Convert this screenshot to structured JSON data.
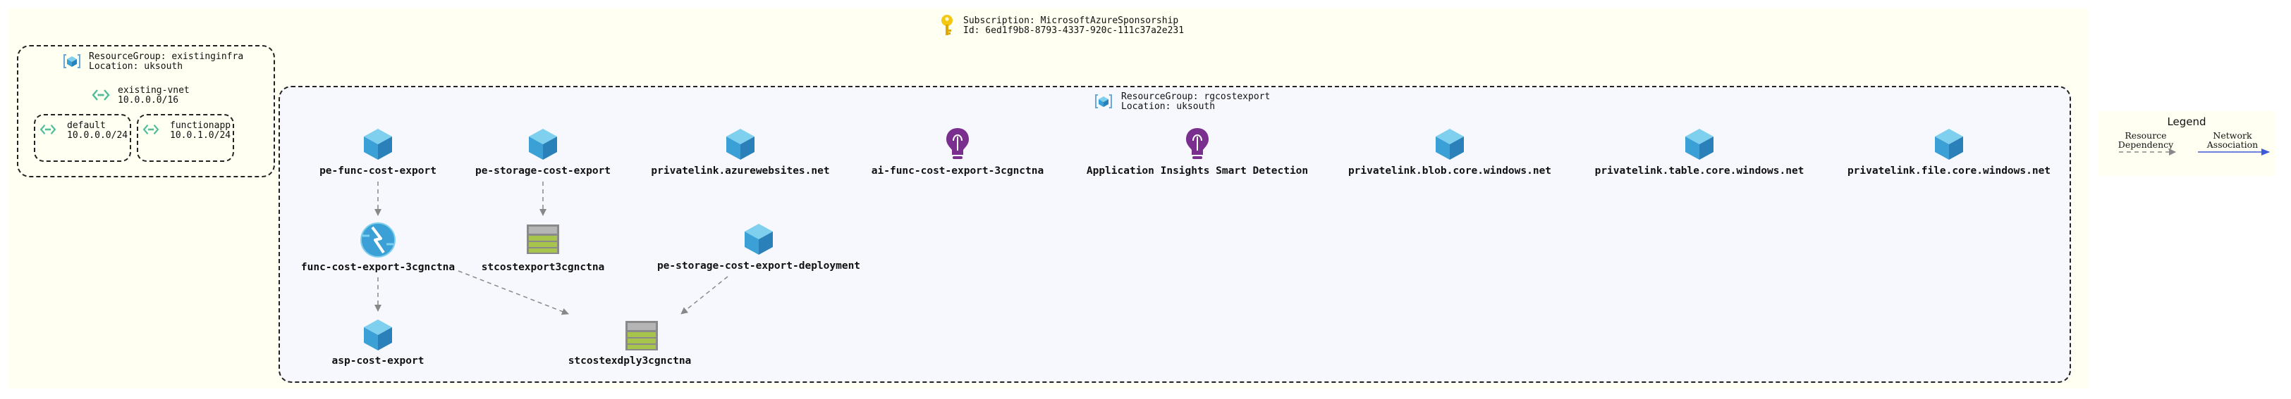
{
  "subscription": {
    "name_line": "Subscription: MicrosoftAzureSponsorship",
    "id_line": "Id: 6ed1f9b8-8793-4337-920c-111c37a2e231"
  },
  "rg_infra": {
    "name_line": "ResourceGroup: existinginfra",
    "location_line": "Location: uksouth",
    "vnet": {
      "name": "existing-vnet",
      "cidr": "10.0.0.0/16"
    },
    "subnets": [
      {
        "name": "default",
        "cidr": "10.0.0.0/24"
      },
      {
        "name": "functionapp",
        "cidr": "10.0.1.0/24"
      }
    ]
  },
  "rg_main": {
    "name_line": "ResourceGroup: rgcostexport",
    "location_line": "Location: uksouth"
  },
  "nodes": {
    "pe_func": "pe-func-cost-export",
    "pe_storage": "pe-storage-cost-export",
    "pl_websites": "privatelink.azurewebsites.net",
    "ai_func": "ai-func-cost-export-3cgnctna",
    "ai_smart": "Application Insights Smart Detection",
    "pl_blob": "privatelink.blob.core.windows.net",
    "pl_table": "privatelink.table.core.windows.net",
    "pl_file": "privatelink.file.core.windows.net",
    "func_app": "func-cost-export-3cgnctna",
    "st_export": "stcostexport3cgnctna",
    "pe_storage_deploy": "pe-storage-cost-export-deployment",
    "asp": "asp-cost-export",
    "st_deploy": "stcostexdply3cgnctna"
  },
  "legend": {
    "title": "Legend",
    "resource_dependency": "Resource\nDependency",
    "network_association": "Network\nAssociation"
  },
  "colors": {
    "background_area": "#fffff2",
    "resource_group_fill": "#f7f8fd",
    "dependency_edge": "#888888",
    "network_edge": "#3b5bdb",
    "cube_light": "#7fd0ef",
    "cube_dark": "#2a8ec2",
    "insights": "#7a2f8f",
    "storage": "#8a8a8a",
    "storage_green": "#a7c44c",
    "key": "#f2c811"
  }
}
